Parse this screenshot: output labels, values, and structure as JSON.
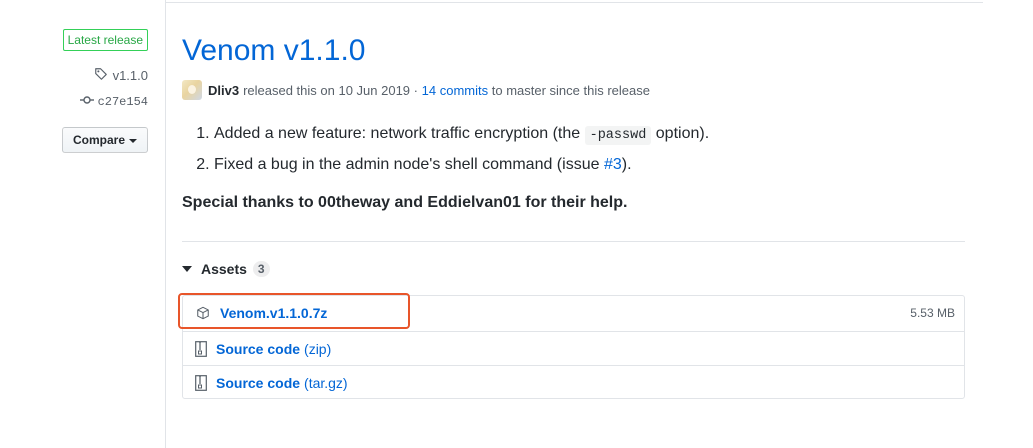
{
  "sidebar": {
    "latest_badge": "Latest release",
    "tag": "v1.1.0",
    "commit": "c27e154",
    "compare_label": "Compare"
  },
  "release": {
    "title": "Venom v1.1.0",
    "author": "Dliv3",
    "released_text": "released this on 10 Jun 2019",
    "separator": "·",
    "commits_link": "14 commits",
    "commits_suffix": "to master since this release"
  },
  "notes": {
    "items": [
      {
        "prefix": "Added a new feature: network traffic encryption (the",
        "code": "-passwd",
        "suffix": "option)."
      },
      {
        "prefix": "Fixed a bug in the admin node's shell command (issue",
        "link": "#3",
        "suffix": ")."
      }
    ],
    "thanks": "Special thanks to 00theway and Eddielvan01 for their help."
  },
  "assets": {
    "heading": "Assets",
    "count": "3",
    "items": [
      {
        "name": "Venom.v1.1.0.7z",
        "ext": "",
        "size": "5.53 MB",
        "icon": "package-icon"
      },
      {
        "name": "Source code",
        "ext": "(zip)",
        "size": "",
        "icon": "file-zip-icon"
      },
      {
        "name": "Source code",
        "ext": "(tar.gz)",
        "size": "",
        "icon": "file-zip-icon"
      }
    ]
  },
  "colors": {
    "link": "#0366d6",
    "latest_green": "#28a745",
    "highlight": "#e8552a"
  }
}
